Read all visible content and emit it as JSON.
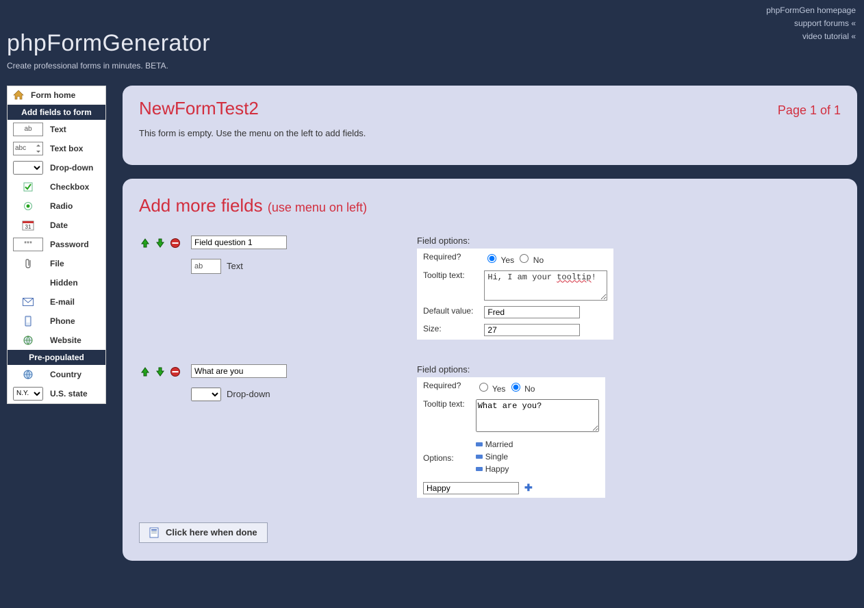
{
  "top_links": {
    "homepage": "phpFormGen homepage",
    "forums": "support forums «",
    "video": "video tutorial «"
  },
  "header": {
    "title": "phpFormGenerator",
    "tagline": "Create professional forms in minutes. BETA."
  },
  "sidebar": {
    "home_label": "Form home",
    "section_add_fields": "Add fields to form",
    "items": [
      {
        "preview": "ab",
        "label": "Text"
      },
      {
        "preview": "abc",
        "label": "Text box",
        "textbox": true
      },
      {
        "preview": "",
        "label": "Drop-down",
        "select": true
      },
      {
        "preview": "",
        "label": "Checkbox",
        "checkbox": true
      },
      {
        "preview": "",
        "label": "Radio",
        "radio": true
      },
      {
        "preview": "31",
        "label": "Date",
        "date": true
      },
      {
        "preview": "***",
        "label": "Password"
      },
      {
        "preview": "",
        "label": "File",
        "file": true
      },
      {
        "preview": "",
        "label": "Hidden",
        "none": true
      },
      {
        "preview": "",
        "label": "E-mail",
        "email": true
      },
      {
        "preview": "",
        "label": "Phone",
        "phone": true
      },
      {
        "preview": "",
        "label": "Website",
        "website": true
      }
    ],
    "section_prepopulated": "Pre-populated",
    "prepopulated": [
      {
        "label": "Country",
        "globe": true
      },
      {
        "label": "U.S. state",
        "select": true,
        "selected": "N.Y."
      }
    ]
  },
  "form_panel": {
    "title": "NewFormTest2",
    "page_indicator": "Page 1 of 1",
    "empty_msg": "This form is empty. Use the menu on the left to add fields."
  },
  "add_panel": {
    "title": "Add more fields",
    "subtitle": "(use menu on left)",
    "field_options_label": "Field options:",
    "labels": {
      "required": "Required?",
      "tooltip": "Tooltip text:",
      "default": "Default value:",
      "size": "Size:",
      "options": "Options:",
      "yes": "Yes",
      "no": "No"
    },
    "fields": [
      {
        "question": "Field question 1",
        "type_label": "Text",
        "type_preview": "ab",
        "required": "yes",
        "tooltip_pre": "Hi, I am your ",
        "tooltip_squiggle": "tooltip",
        "tooltip_post": "!",
        "default_value": "Fred",
        "size": "27"
      },
      {
        "question": "What are you",
        "type_label": "Drop-down",
        "is_select": true,
        "required": "no",
        "tooltip": "What are you?",
        "options": [
          "Married",
          "Single",
          "Happy"
        ],
        "new_option": "Happy"
      }
    ],
    "done_label": "Click here when done"
  }
}
